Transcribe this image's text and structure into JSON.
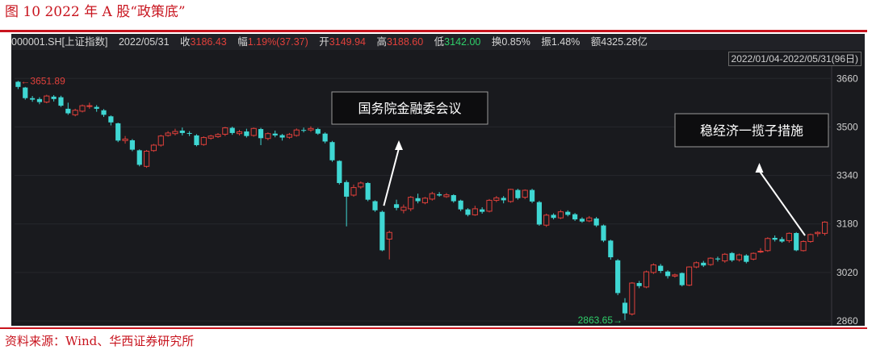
{
  "figure": {
    "title": "图 10 2022 年 A 股“政策底”",
    "source": "资料来源：Wind、华西证券研究所"
  },
  "ticker_bar": {
    "code": "000001.SH[上证指数]",
    "date": "2022/05/31",
    "close_label": "收",
    "close_value": "3186.43",
    "change_label": "幅",
    "change_value": "1.19%(37.37)",
    "open_label": "开",
    "open_value": "3149.94",
    "high_label": "高",
    "high_value": "3188.60",
    "low_label": "低",
    "low_value": "3142.00",
    "turnover_label": "换",
    "turnover_value": "0.85%",
    "amplitude_label": "振",
    "amplitude_value": "1.48%",
    "amount_label": "额",
    "amount_value": "4325.28亿",
    "range": "2022/01/04-2022/05/31(96日)"
  },
  "colors": {
    "up": "#e0403b",
    "down": "#3fd7d3",
    "panel_bg": "#191a1e",
    "annotation_box": "#0d0d0f",
    "accent": "#c8141e"
  },
  "chart_data": {
    "type": "candlestick",
    "ylim": [
      2860,
      3690
    ],
    "yticks": [
      "3660",
      "3500",
      "3340",
      "3180",
      "3020",
      "2860"
    ],
    "ytick_values": [
      3660,
      3500,
      3340,
      3180,
      3020,
      2860
    ],
    "max_label": "3651.89",
    "min_label": "2863.65",
    "candles": [
      [
        3649,
        3632,
        3652,
        3625
      ],
      [
        3630,
        3595,
        3632,
        3590
      ],
      [
        3595,
        3590,
        3602,
        3583
      ],
      [
        3592,
        3582,
        3598,
        3575
      ],
      [
        3582,
        3602,
        3606,
        3578
      ],
      [
        3600,
        3592,
        3605,
        3584
      ],
      [
        3598,
        3570,
        3603,
        3566
      ],
      [
        3560,
        3545,
        3580,
        3540
      ],
      [
        3540,
        3555,
        3560,
        3535
      ],
      [
        3552,
        3570,
        3574,
        3548
      ],
      [
        3568,
        3570,
        3580,
        3560
      ],
      [
        3566,
        3560,
        3572,
        3550
      ],
      [
        3555,
        3540,
        3559,
        3533
      ],
      [
        3535,
        3515,
        3538,
        3505
      ],
      [
        3512,
        3455,
        3514,
        3450
      ],
      [
        3455,
        3460,
        3470,
        3445
      ],
      [
        3456,
        3425,
        3460,
        3420
      ],
      [
        3423,
        3375,
        3426,
        3370
      ],
      [
        3370,
        3420,
        3424,
        3365
      ],
      [
        3422,
        3440,
        3444,
        3418
      ],
      [
        3440,
        3470,
        3474,
        3435
      ],
      [
        3472,
        3480,
        3486,
        3468
      ],
      [
        3478,
        3485,
        3494,
        3472
      ],
      [
        3488,
        3480,
        3498,
        3472
      ],
      [
        3480,
        3478,
        3486,
        3470
      ],
      [
        3472,
        3440,
        3476,
        3436
      ],
      [
        3442,
        3465,
        3469,
        3438
      ],
      [
        3463,
        3470,
        3474,
        3458
      ],
      [
        3468,
        3475,
        3480,
        3464
      ],
      [
        3476,
        3497,
        3500,
        3470
      ],
      [
        3497,
        3480,
        3501,
        3474
      ],
      [
        3478,
        3484,
        3490,
        3472
      ],
      [
        3485,
        3470,
        3494,
        3465
      ],
      [
        3472,
        3495,
        3498,
        3468
      ],
      [
        3493,
        3463,
        3497,
        3440
      ],
      [
        3462,
        3478,
        3482,
        3456
      ],
      [
        3478,
        3472,
        3488,
        3466
      ],
      [
        3473,
        3465,
        3477,
        3455
      ],
      [
        3466,
        3475,
        3480,
        3461
      ],
      [
        3472,
        3490,
        3495,
        3468
      ],
      [
        3490,
        3488,
        3498,
        3482
      ],
      [
        3490,
        3495,
        3502,
        3484
      ],
      [
        3493,
        3478,
        3497,
        3474
      ],
      [
        3478,
        3452,
        3482,
        3446
      ],
      [
        3450,
        3390,
        3454,
        3385
      ],
      [
        3388,
        3315,
        3390,
        3310
      ],
      [
        3318,
        3270,
        3324,
        3172
      ],
      [
        3275,
        3300,
        3310,
        3270
      ],
      [
        3302,
        3315,
        3320,
        3296
      ],
      [
        3315,
        3260,
        3318,
        3255
      ],
      [
        3255,
        3225,
        3258,
        3220
      ],
      [
        3220,
        3093,
        3224,
        3090
      ],
      [
        3130,
        3152,
        3158,
        3063
      ],
      [
        3245,
        3233,
        3260,
        3225
      ],
      [
        3225,
        3235,
        3244,
        3215
      ],
      [
        3230,
        3268,
        3272,
        3222
      ],
      [
        3265,
        3255,
        3280,
        3248
      ],
      [
        3250,
        3265,
        3269,
        3245
      ],
      [
        3262,
        3280,
        3286,
        3257
      ],
      [
        3278,
        3274,
        3285,
        3270
      ],
      [
        3270,
        3276,
        3282,
        3266
      ],
      [
        3275,
        3255,
        3278,
        3250
      ],
      [
        3257,
        3228,
        3260,
        3222
      ],
      [
        3228,
        3210,
        3232,
        3205
      ],
      [
        3210,
        3230,
        3240,
        3207
      ],
      [
        3228,
        3220,
        3235,
        3214
      ],
      [
        3222,
        3258,
        3262,
        3218
      ],
      [
        3258,
        3266,
        3272,
        3252
      ],
      [
        3266,
        3258,
        3272,
        3248
      ],
      [
        3254,
        3294,
        3296,
        3250
      ],
      [
        3292,
        3265,
        3296,
        3260
      ],
      [
        3268,
        3291,
        3294,
        3262
      ],
      [
        3292,
        3254,
        3296,
        3249
      ],
      [
        3252,
        3178,
        3256,
        3174
      ],
      [
        3176,
        3209,
        3214,
        3170
      ],
      [
        3210,
        3200,
        3215,
        3195
      ],
      [
        3200,
        3220,
        3226,
        3196
      ],
      [
        3220,
        3210,
        3225,
        3205
      ],
      [
        3212,
        3195,
        3216,
        3190
      ],
      [
        3197,
        3188,
        3202,
        3184
      ],
      [
        3190,
        3200,
        3206,
        3186
      ],
      [
        3198,
        3175,
        3203,
        3170
      ],
      [
        3175,
        3125,
        3178,
        3120
      ],
      [
        3125,
        3070,
        3128,
        3062
      ],
      [
        3060,
        2952,
        3064,
        2945
      ],
      [
        2920,
        2885,
        2935,
        2863
      ],
      [
        2883,
        2985,
        2988,
        2878
      ],
      [
        2985,
        2975,
        2992,
        2968
      ],
      [
        2972,
        3022,
        3026,
        2968
      ],
      [
        3020,
        3045,
        3050,
        3015
      ],
      [
        3042,
        3025,
        3048,
        3018
      ],
      [
        3023,
        3008,
        3027,
        3000
      ],
      [
        3008,
        3012,
        3016,
        3003
      ],
      [
        3018,
        2978,
        3020,
        2974
      ],
      [
        2978,
        3038,
        3040,
        2975
      ],
      [
        3038,
        3052,
        3056,
        3034
      ],
      [
        3052,
        3043,
        3058,
        3038
      ],
      [
        3046,
        3067,
        3070,
        3042
      ],
      [
        3066,
        3063,
        3072,
        3056
      ],
      [
        3058,
        3080,
        3084,
        3052
      ],
      [
        3084,
        3060,
        3087,
        3055
      ],
      [
        3062,
        3078,
        3082,
        3056
      ],
      [
        3076,
        3055,
        3080,
        3050
      ],
      [
        3064,
        3083,
        3086,
        3060
      ],
      [
        3088,
        3090,
        3100,
        3084
      ],
      [
        3092,
        3132,
        3136,
        3088
      ],
      [
        3134,
        3128,
        3142,
        3122
      ],
      [
        3130,
        3122,
        3137,
        3118
      ],
      [
        3125,
        3149,
        3152,
        3118
      ],
      [
        3150,
        3093,
        3153,
        3090
      ],
      [
        3092,
        3122,
        3126,
        3089
      ],
      [
        3122,
        3145,
        3148,
        3118
      ],
      [
        3148,
        3152,
        3156,
        3138
      ],
      [
        3149,
        3186,
        3189,
        3142
      ]
    ],
    "annotations": [
      {
        "text": "国务院金融委会议",
        "arrow_to_index": 51
      },
      {
        "text": "稳经济一揽子措施",
        "arrow_to_index": 110
      }
    ]
  }
}
